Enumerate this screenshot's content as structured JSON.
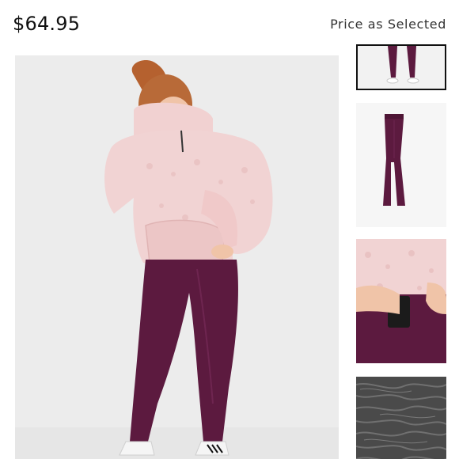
{
  "product": {
    "price": "$64.95",
    "price_note": "Price as Selected"
  },
  "images": {
    "main": {
      "description_icon": "model-photo-icon"
    },
    "thumbnails": [
      {
        "name": "thumbnail-full-outfit",
        "selected": true
      },
      {
        "name": "thumbnail-legging-flat",
        "selected": false
      },
      {
        "name": "thumbnail-pocket-detail",
        "selected": false
      },
      {
        "name": "thumbnail-fabric-texture",
        "selected": false
      }
    ]
  },
  "colors": {
    "hoodie_pink": "#f1d3d3",
    "legging_plum": "#5c1a3f",
    "background_gray": "#ededed",
    "selected_border": "#111111"
  }
}
